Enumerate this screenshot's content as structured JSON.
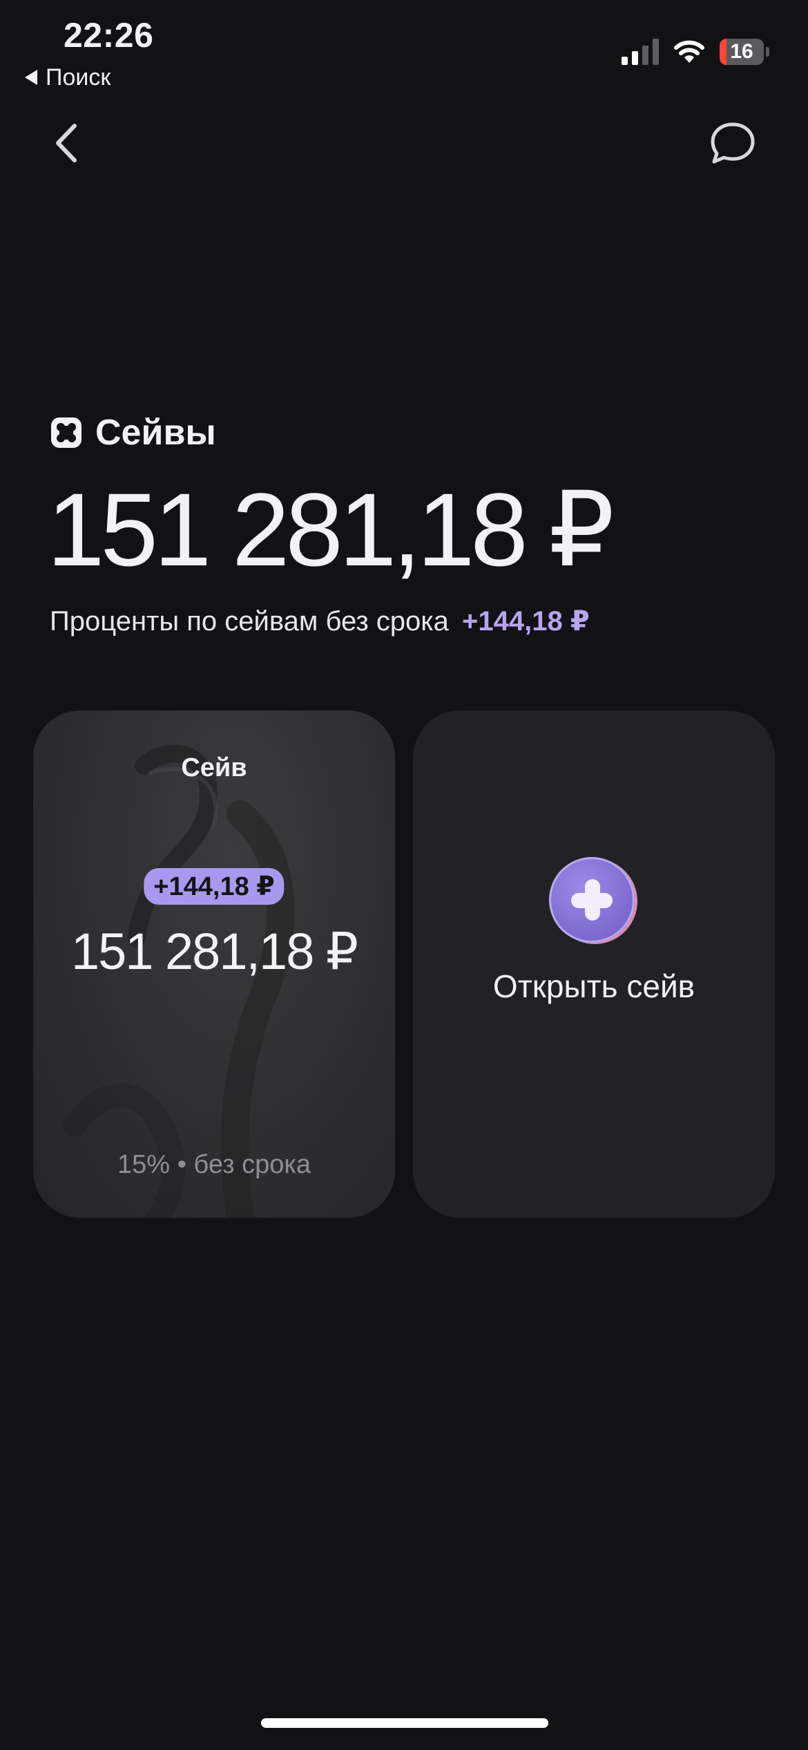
{
  "status_bar": {
    "time": "22:26",
    "back_app_label": "Поиск",
    "battery_level": "16",
    "icons": [
      "signal-icon",
      "wifi-icon",
      "battery-icon"
    ]
  },
  "nav": {
    "back_icon": "chevron-left-icon",
    "chat_icon": "chat-bubble-icon"
  },
  "header": {
    "section_icon": "saves-icon",
    "section_title": "Сейвы",
    "total_amount": "151 281,18 ₽",
    "interest_label": "Проценты по сейвам без срока",
    "interest_value": "+144,18 ₽"
  },
  "cards": {
    "save": {
      "title": "Сейв",
      "badge": "+144,18 ₽",
      "amount": "151 281,18 ₽",
      "rate_line": "15% • без срока"
    },
    "open": {
      "icon": "plus-icon",
      "label": "Открыть сейв"
    }
  },
  "colors": {
    "background": "#121214",
    "accent": "#a999ee",
    "card": "#222226"
  }
}
